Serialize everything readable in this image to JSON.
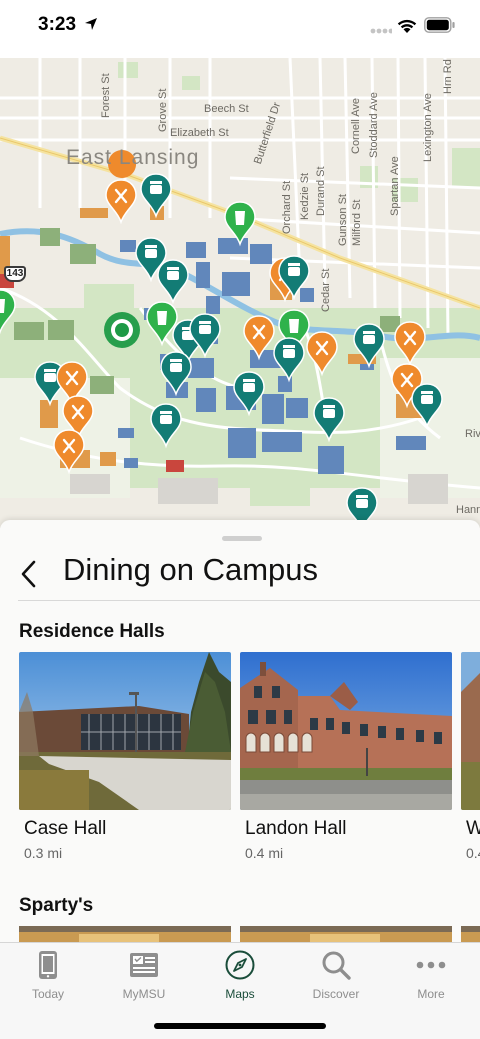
{
  "status_bar": {
    "time": "3:23"
  },
  "map": {
    "city_label": "East Lansing",
    "highway_shield": "143",
    "streets": {
      "forest": "Forest St",
      "grove": "Grove St",
      "beech": "Beech St",
      "elizabeth": "Elizabeth St",
      "butterfield": "Butterfield Dr",
      "orchard": "Orchard St",
      "kedzie": "Kedzie St",
      "durand": "Durand St",
      "gunson": "Gunson St",
      "milford": "Milford St",
      "cedar": "Cedar St",
      "cornell": "Cornell Ave",
      "stoddard": "Stoddard Ave",
      "spartan": "Spartan Ave",
      "lexington": "Lexington Ave",
      "harrison": "Hrn Rd",
      "river": "Riv",
      "hann": "Hann"
    },
    "colors": {
      "dining_orange": "#ef8a2c",
      "dining_teal": "#137c75",
      "cafe_green": "#2fb24b",
      "user_green": "#1d9a46",
      "building": "#5e84b8",
      "water": "#8fc1e3"
    }
  },
  "sheet": {
    "title": "Dining on Campus",
    "sections": [
      {
        "title": "Residence Halls",
        "cards": [
          {
            "name": "Case Hall",
            "distance": "0.3 mi"
          },
          {
            "name": "Landon Hall",
            "distance": "0.4 mi"
          },
          {
            "name": "W",
            "distance": "0.4"
          }
        ]
      },
      {
        "title": "Sparty's"
      }
    ]
  },
  "tab_bar": {
    "tabs": [
      {
        "label": "Today",
        "icon": "phone-icon"
      },
      {
        "label": "MyMSU",
        "icon": "card-icon"
      },
      {
        "label": "Maps",
        "icon": "compass-icon",
        "active": true
      },
      {
        "label": "Discover",
        "icon": "search-icon"
      },
      {
        "label": "More",
        "icon": "more-icon"
      }
    ],
    "active_color": "#1a4d3a",
    "inactive_color": "#8e8e8e"
  }
}
